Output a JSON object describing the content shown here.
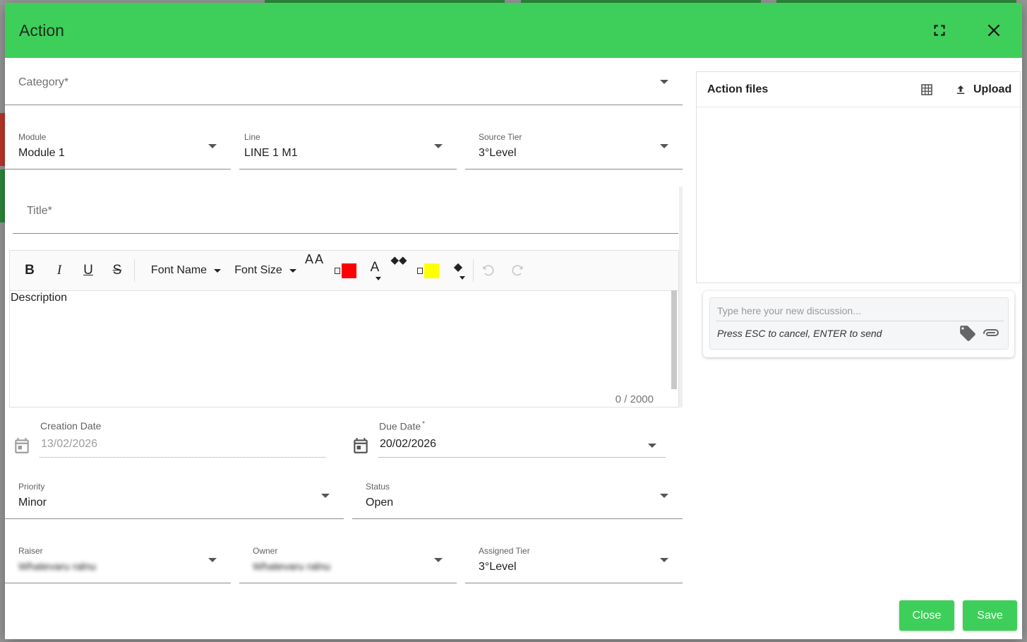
{
  "dialog": {
    "title": "Action"
  },
  "fields": {
    "category": {
      "placeholder": "Category*"
    },
    "module": {
      "label": "Module",
      "value": "Module 1"
    },
    "line": {
      "label": "Line",
      "value": "LINE 1 M1"
    },
    "source_tier": {
      "label": "Source Tier",
      "value": "3°Level"
    },
    "title": {
      "placeholder": "Title*"
    },
    "description": {
      "placeholder": "Description",
      "count": "0 / 2000"
    },
    "creation_date": {
      "label": "Creation Date",
      "value": "13/02/2026"
    },
    "due_date": {
      "label": "Due Date",
      "required_mark": "*",
      "value": "20/02/2026"
    },
    "priority": {
      "label": "Priority",
      "value": "Minor"
    },
    "status": {
      "label": "Status",
      "value": "Open"
    },
    "raiser": {
      "label": "Raiser",
      "value": "Whatevaru ralnu"
    },
    "owner": {
      "label": "Owner",
      "value": "Whatevaru ralnu"
    },
    "assigned_tier": {
      "label": "Assigned Tier",
      "value": "3°Level"
    }
  },
  "toolbar": {
    "bold": "B",
    "italic": "I",
    "underline": "U",
    "strike": "S",
    "font_name": "Font Name",
    "font_size": "Font Size",
    "text_case": "AA",
    "font_color_letter": "A",
    "font_color": "#ff0000",
    "bg_color": "#ffff00"
  },
  "files": {
    "title": "Action files",
    "upload_label": "Upload"
  },
  "discussion": {
    "placeholder": "Type here your new discussion...",
    "hint": "Press ESC to cancel, ENTER to send"
  },
  "buttons": {
    "close": "Close",
    "save": "Save"
  },
  "colors": {
    "accent": "#3ecf5a"
  }
}
